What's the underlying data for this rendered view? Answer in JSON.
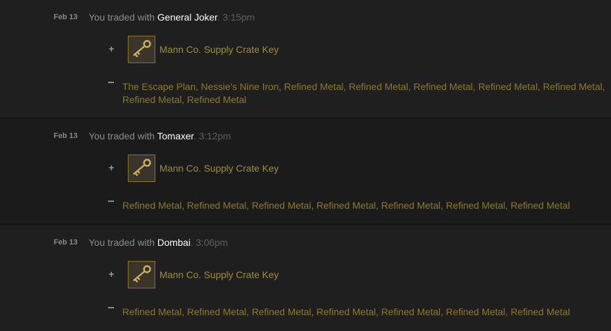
{
  "trades": [
    {
      "date": "Feb 13",
      "prefix": "You traded with",
      "partner": "General Joker",
      "time": ". 3:15pm",
      "received_item": "Mann Co. Supply Crate Key",
      "received_icon": "key-icon",
      "given_items": "The Escape Plan, Nessie's Nine Iron, Refined Metal, Refined Metal, Refined Metal, Refined Metal, Refined Metal, Refined Metal, Refined Metal"
    },
    {
      "date": "Feb 13",
      "prefix": "You traded with",
      "partner": "Tomaxer",
      "time": ". 3:12pm",
      "received_item": "Mann Co. Supply Crate Key",
      "received_icon": "key-icon",
      "given_items": "Refined Metal, Refined Metal, Refined Metal, Refined Metal, Refined Metal, Refined Metal, Refined Metal"
    },
    {
      "date": "Feb 13",
      "prefix": "You traded with",
      "partner": "Dombai",
      "time": ". 3:06pm",
      "received_item": "Mann Co. Supply Crate Key",
      "received_icon": "key-icon",
      "given_items": "Refined Metal, Refined Metal, Refined Metal, Refined Metal, Refined Metal, Refined Metal, Refined Metal"
    }
  ],
  "colors": {
    "background": "#1e1e1e",
    "partner": "#ffffff",
    "item_text": "#8b7b2a",
    "item_border": "#8a7427"
  }
}
